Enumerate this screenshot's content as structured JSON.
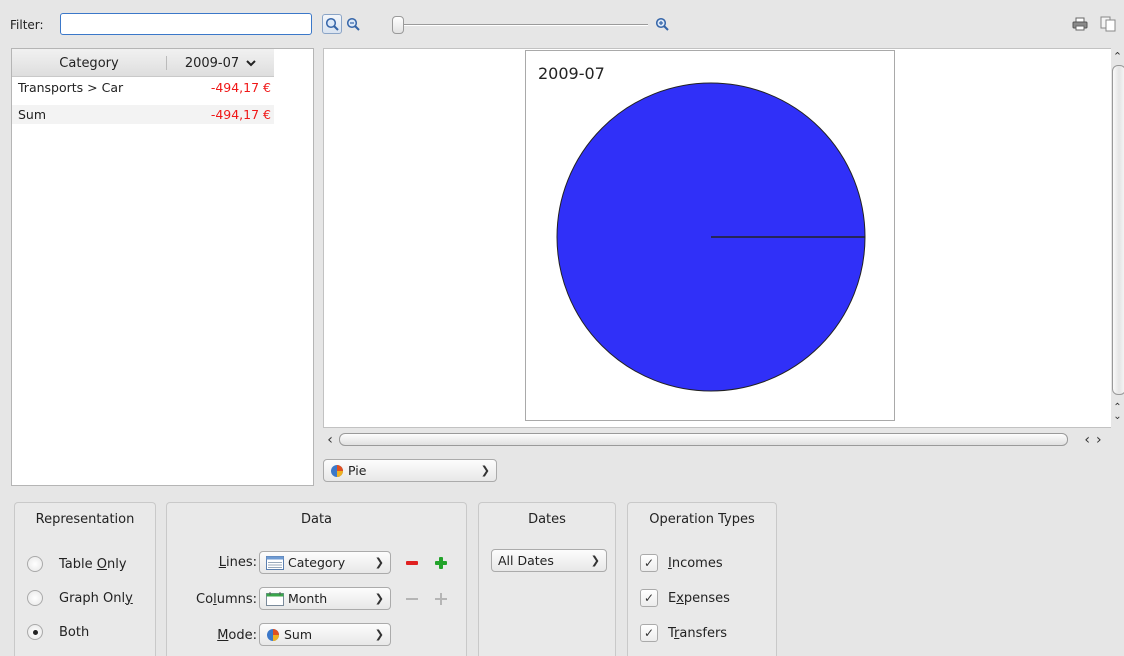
{
  "toolbar": {
    "filter_label": "Filter:",
    "filter_value": "",
    "zoom_level": 0
  },
  "table": {
    "columns": [
      "Category",
      "2009-07"
    ],
    "rows": [
      {
        "category": "Transports > Car",
        "value": "-494,17 €"
      },
      {
        "category": "Sum",
        "value": "-494,17 €"
      }
    ]
  },
  "chart_data": {
    "type": "pie",
    "title": "2009-07",
    "categories": [
      "Transports > Car"
    ],
    "values": [
      494.17
    ],
    "colors": [
      "#3030f8"
    ]
  },
  "graph_type": {
    "selected": "Pie",
    "icon": "pie-chart-icon"
  },
  "representation": {
    "title": "Representation",
    "options": [
      {
        "pre": "Table ",
        "key": "O",
        "post": "nly",
        "checked": false
      },
      {
        "pre": "Graph Onl",
        "key": "y",
        "post": "",
        "checked": false
      },
      {
        "pre": "Both",
        "key": "",
        "post": "",
        "checked": true
      }
    ]
  },
  "data": {
    "title": "Data",
    "lines": {
      "label_pre": "",
      "label_key": "L",
      "label_post": "ines:",
      "value": "Category",
      "icon": "table-icon"
    },
    "columns": {
      "label_pre": "Co",
      "label_key": "l",
      "label_post": "umns:",
      "value": "Month",
      "icon": "calendar-icon"
    },
    "mode": {
      "label_pre": "",
      "label_key": "M",
      "label_post": "ode:",
      "value": "Sum",
      "icon": "pie-chart-icon"
    }
  },
  "dates": {
    "title": "Dates",
    "selected": "All Dates"
  },
  "operation_types": {
    "title": "Operation Types",
    "items": [
      {
        "pre": "",
        "key": "I",
        "post": "ncomes",
        "checked": true
      },
      {
        "pre": "E",
        "key": "x",
        "post": "penses",
        "checked": true
      },
      {
        "pre": "T",
        "key": "r",
        "post": "ansfers",
        "checked": true
      }
    ]
  },
  "colors": {
    "negative": "#f01818",
    "pie": "#3030f8",
    "add": "#22a32a",
    "remove": "#e02020"
  }
}
